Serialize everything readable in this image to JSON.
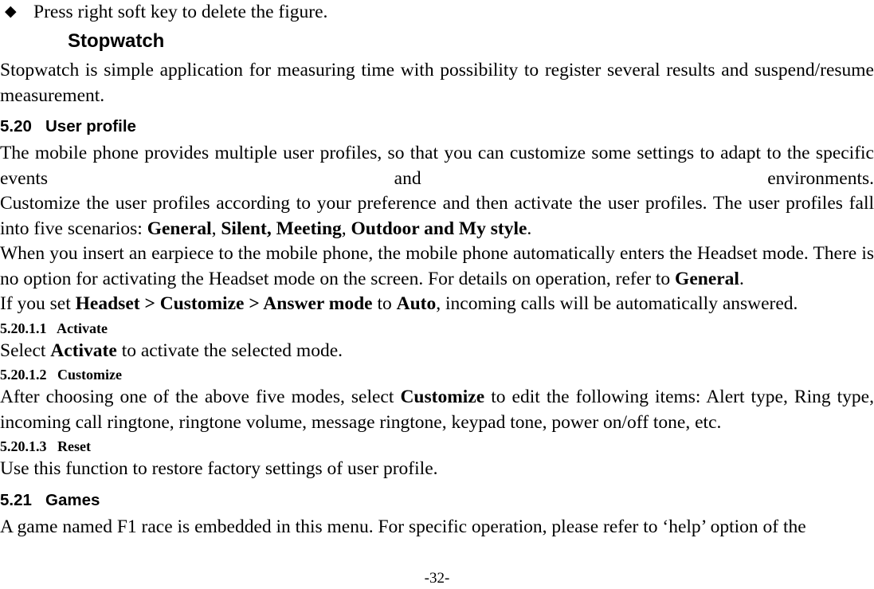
{
  "document": {
    "page_number_label": "-32-",
    "bullet_glyph": "◆"
  },
  "blocks": {
    "bullet_item": "Press right soft key to delete the figure.",
    "stopwatch_heading": "Stopwatch",
    "stopwatch_paragraph": "Stopwatch is simple application for measuring time with possibility to register several results and suspend/resume measurement.",
    "section_520_number": "5.20",
    "section_520_title": "User profile",
    "para_mobile_provides": "The mobile phone provides multiple user profiles, so that you can customize some settings to adapt to the specific events and environments.",
    "para_customize_pre": "Customize the user profiles according to your preference and then activate the user profiles. The user profiles fall into five scenarios: ",
    "para_customize_b1": "General",
    "para_customize_mid1": ", ",
    "para_customize_b2": "Silent, Meeting",
    "para_customize_mid2": ", ",
    "para_customize_b3": "Outdoor and My style",
    "para_customize_end": ".",
    "para_headset_pre": "When you insert an earpiece to the mobile phone, the mobile phone automatically enters the Headset mode. There is no option for activating the Headset mode on the screen. For details on operation, refer to ",
    "para_headset_b1": "General",
    "para_headset_end": ".",
    "para_answer_pre": "If you set ",
    "para_answer_b1": "Headset > Customize > Answer mode",
    "para_answer_mid": " to ",
    "para_answer_b2": "Auto",
    "para_answer_end": ", incoming calls will be automatically answered.",
    "sub_5201_1_number": "5.20.1.1",
    "sub_5201_1_title": "Activate",
    "para_activate_pre": "Select ",
    "para_activate_b1": "Activate",
    "para_activate_end": " to activate the selected mode.",
    "sub_5201_2_number": "5.20.1.2",
    "sub_5201_2_title": "Customize",
    "para_customize2_pre": "After choosing one of the above five modes, select ",
    "para_customize2_b1": "Customize",
    "para_customize2_end": " to edit the following items: Alert type, Ring type, incoming call ringtone, ringtone volume, message ringtone, keypad tone, power on/off tone, etc.",
    "sub_5201_3_number": "5.20.1.3",
    "sub_5201_3_title": "Reset",
    "para_reset": "Use this function to restore factory settings of user profile.",
    "section_521_number": "5.21",
    "section_521_title": "Games",
    "para_games": "A game named F1 race is embedded in this menu. For specific operation, please refer to ‘help’ option of the"
  }
}
